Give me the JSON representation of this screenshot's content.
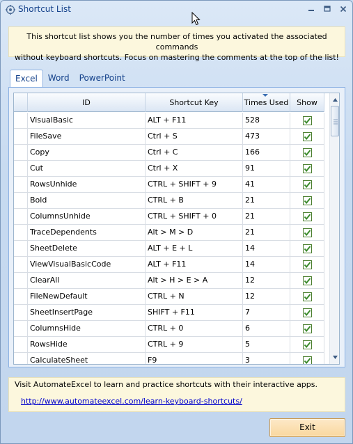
{
  "window": {
    "title": "Shortcut List",
    "minimize_icon": "minimize-icon",
    "maximize_icon": "maximize-icon",
    "close_icon": "close-icon"
  },
  "info": {
    "line1": "This shortcut list shows you the number of times you activated the associated commands",
    "line2": "without keyboard shortcuts. Focus on mastering the comments at the top of the list!"
  },
  "tabs": [
    {
      "label": "Excel",
      "active": true
    },
    {
      "label": "Word",
      "active": false
    },
    {
      "label": "PowerPoint",
      "active": false
    }
  ],
  "grid": {
    "columns": [
      "",
      "ID",
      "Shortcut Key",
      "Times Used",
      "Show"
    ],
    "sorted_column": "Times Used",
    "rows": [
      {
        "id": "VisualBasic",
        "key": "ALT + F11",
        "times": "528",
        "show": true
      },
      {
        "id": "FileSave",
        "key": "Ctrl + S",
        "times": "473",
        "show": true
      },
      {
        "id": "Copy",
        "key": "Ctrl + C",
        "times": "166",
        "show": true
      },
      {
        "id": "Cut",
        "key": "Ctrl + X",
        "times": "91",
        "show": true
      },
      {
        "id": "RowsUnhide",
        "key": "CTRL + SHIFT + 9",
        "times": "41",
        "show": true
      },
      {
        "id": "Bold",
        "key": "CTRL + B",
        "times": "21",
        "show": true
      },
      {
        "id": "ColumnsUnhide",
        "key": "CTRL + SHIFT + 0",
        "times": "21",
        "show": true
      },
      {
        "id": "TraceDependents",
        "key": "Alt > M > D",
        "times": "21",
        "show": true
      },
      {
        "id": "SheetDelete",
        "key": "ALT + E + L",
        "times": "14",
        "show": true
      },
      {
        "id": "ViewVisualBasicCode",
        "key": "ALT + F11",
        "times": "14",
        "show": true
      },
      {
        "id": "ClearAll",
        "key": "Alt > H > E > A",
        "times": "12",
        "show": true
      },
      {
        "id": "FileNewDefault",
        "key": "CTRL + N",
        "times": "12",
        "show": true
      },
      {
        "id": "SheetInsertPage",
        "key": "SHIFT + F11",
        "times": "7",
        "show": true
      },
      {
        "id": "ColumnsHide",
        "key": "CTRL + 0",
        "times": "6",
        "show": true
      },
      {
        "id": "RowsHide",
        "key": "CTRL + 9",
        "times": "5",
        "show": true
      },
      {
        "id": "CalculateSheet",
        "key": "F9",
        "times": "3",
        "show": true
      }
    ]
  },
  "footer": {
    "text": "Visit AutomateExcel to learn and practice shortcuts with their interactive apps.",
    "link": "http://www.automateexcel.com/learn-keyboard-shortcuts/"
  },
  "buttons": {
    "exit": "Exit"
  },
  "colors": {
    "accent": "#15428b",
    "check": "#3a8a2a",
    "info_bg": "#fcf7dd"
  }
}
